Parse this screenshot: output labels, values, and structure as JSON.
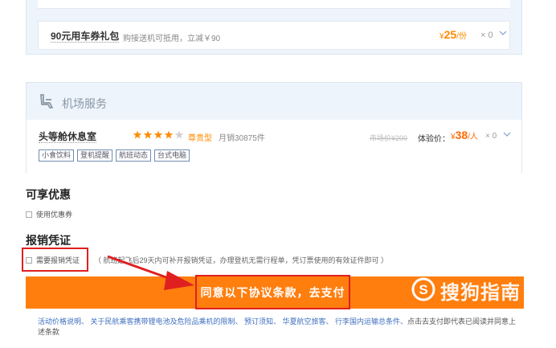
{
  "voucher": {
    "title": "90元用车券礼包",
    "desc": "购接送机可抵用，立减￥90",
    "price_prefix": "¥",
    "price": "25",
    "price_unit": "/份",
    "qty": "× 0"
  },
  "airport_service": {
    "title": "机场服务",
    "lounge": {
      "name": "头等舱休息室",
      "rating": 4,
      "rating_max": 5,
      "type": "尊贵型",
      "sales": "月销30875件",
      "market_price": "市场价¥200",
      "exp_label": "体验价：",
      "price_prefix": "¥",
      "price": "38",
      "price_unit": "/人",
      "qty": "× 0",
      "tags": [
        "小食饮料",
        "登机提醒",
        "航班动态",
        "台式电脑"
      ]
    }
  },
  "discount": {
    "title": "可享优惠",
    "coupon_label": "使用优惠券"
  },
  "invoice": {
    "title": "报销凭证",
    "need_label": "需要报销凭证",
    "note": "（ 航班起飞后29天内可补开报销凭证，办理登机无需行程单，凭订票使用的有效证件即可 ）"
  },
  "pay_button": "同意以下协议条款，去支付",
  "terms": {
    "links": "活动价格说明、 关于民航乘客携带锂电池及危险品乘机的限制、 预订须知、 华夏航空旅客、 行李国内运输总条件、",
    "tail": "点击去支付即代表已阅读并同意上述条款"
  },
  "watermark": "搜狗指南",
  "colors": {
    "accent": "#ff7e0e",
    "price": "#ff8a00",
    "highlight_border": "#e02020",
    "link": "#3d6ebf"
  }
}
